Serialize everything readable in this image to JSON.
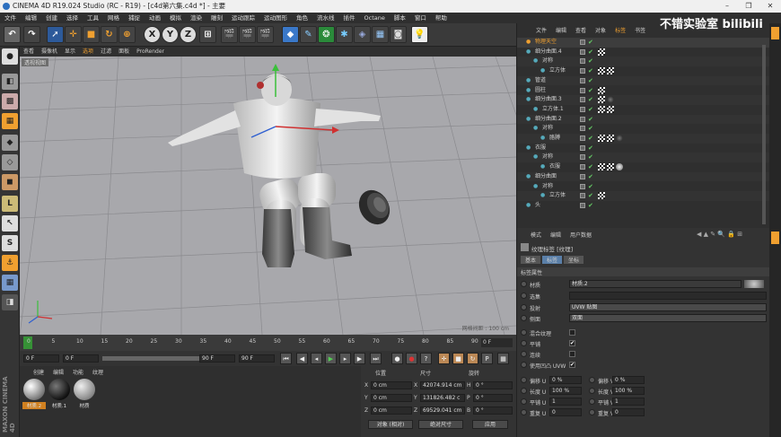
{
  "app": {
    "title": "CINEMA 4D R19.024 Studio (RC - R19) - [c4d第六集.c4d *] - 主要"
  },
  "menu": [
    "文件",
    "编辑",
    "创建",
    "选择",
    "工具",
    "网格",
    "捕捉",
    "动画",
    "模拟",
    "渲染",
    "雕刻",
    "运动跟踪",
    "运动图形",
    "角色",
    "流水线",
    "插件",
    "Octane",
    "脚本",
    "窗口",
    "帮助"
  ],
  "toolbar": {
    "x": "X",
    "y": "Y",
    "z": "Z"
  },
  "viewport": {
    "menu": [
      "查看",
      "摄像机",
      "显示",
      "选项",
      "过滤",
      "面板",
      "ProRender"
    ],
    "name": "透视视图",
    "grid_info": "网格间距 : 100 cm"
  },
  "timeline": {
    "ticks": [
      "0",
      "5",
      "10",
      "15",
      "20",
      "25",
      "30",
      "35",
      "40",
      "45",
      "50",
      "55",
      "60",
      "65",
      "70",
      "75",
      "80",
      "85",
      "90"
    ],
    "frame_display": "0 F"
  },
  "transport": {
    "start": "0 F",
    "current": "0 F",
    "end": "90 F",
    "end2": "90 F"
  },
  "materials": {
    "menu": [
      "创建",
      "编辑",
      "功能",
      "纹理"
    ],
    "items": [
      {
        "name": "材质.2"
      },
      {
        "name": "材质.1"
      },
      {
        "name": "材质"
      }
    ]
  },
  "coords": {
    "headers": [
      "位置",
      "尺寸",
      "旋转"
    ],
    "rows": [
      {
        "axis": "X",
        "pos": "0 cm",
        "size": "42074.914 cm",
        "rot_axis": "H",
        "rot": "0 °"
      },
      {
        "axis": "Y",
        "pos": "0 cm",
        "size": "131826.482 c",
        "rot_axis": "P",
        "rot": "0 °"
      },
      {
        "axis": "Z",
        "pos": "0 cm",
        "size": "69529.041 cm",
        "rot_axis": "B",
        "rot": "0 °"
      }
    ],
    "mode": "对象 (相对)",
    "size_mode": "绝对尺寸",
    "apply": "应用"
  },
  "objmgr": {
    "tabs": [
      "文件",
      "编辑",
      "查看",
      "对象",
      "标签",
      "书签"
    ],
    "items": [
      {
        "name": "物理天空",
        "indent": 0
      },
      {
        "name": "细分曲面.4",
        "indent": 0
      },
      {
        "name": "对称",
        "indent": 1
      },
      {
        "name": "立方体",
        "indent": 2
      },
      {
        "name": "管道",
        "indent": 0
      },
      {
        "name": "圆柱",
        "indent": 0
      },
      {
        "name": "细分曲面.3",
        "indent": 0
      },
      {
        "name": "立方体.1",
        "indent": 1
      },
      {
        "name": "细分曲面.2",
        "indent": 0
      },
      {
        "name": "对称",
        "indent": 1
      },
      {
        "name": "胳膊",
        "indent": 2
      },
      {
        "name": "衣服",
        "indent": 0
      },
      {
        "name": "对称",
        "indent": 1
      },
      {
        "name": "衣服",
        "indent": 2
      },
      {
        "name": "细分曲面",
        "indent": 0
      },
      {
        "name": "对称",
        "indent": 1
      },
      {
        "name": "立方体",
        "indent": 2
      },
      {
        "name": "头",
        "indent": 0
      }
    ]
  },
  "attr": {
    "menu": [
      "模式",
      "编辑",
      "用户数据"
    ],
    "title": "纹理标签 [纹理]",
    "tabs": [
      "基本",
      "标签",
      "坐标"
    ],
    "section": "标签属性",
    "material_label": "材质",
    "material_value": "材质.2",
    "selection_label": "选集",
    "projection_label": "投射",
    "projection_value": "UVW 贴图",
    "side_label": "侧面",
    "side_value": "双面",
    "mix_label": "混合纹理",
    "tile_label": "平铺",
    "seamless_label": "连续",
    "uvw_label": "使用凹凸 UVW",
    "offset_u": "偏移 U",
    "offset_u_val": "0 %",
    "offset_v": "偏移 V",
    "offset_v_val": "0 %",
    "len_u": "长度 U",
    "len_u_val": "100 %",
    "len_v": "长度 V",
    "len_v_val": "100 %",
    "tile_u": "平铺 U",
    "tile_u_val": "1",
    "tile_v": "平铺 V",
    "tile_v_val": "1",
    "rep_u": "重复 U",
    "rep_u_val": "0",
    "rep_v": "重复 V",
    "rep_v_val": "0"
  },
  "watermark": "不错实验室 bilibili",
  "side_logo": "MAXON CINEMA 4D",
  "colors": {
    "accent": "#f0a030",
    "bg": "#3b3b3b",
    "viewport": "#a8a8ac"
  }
}
